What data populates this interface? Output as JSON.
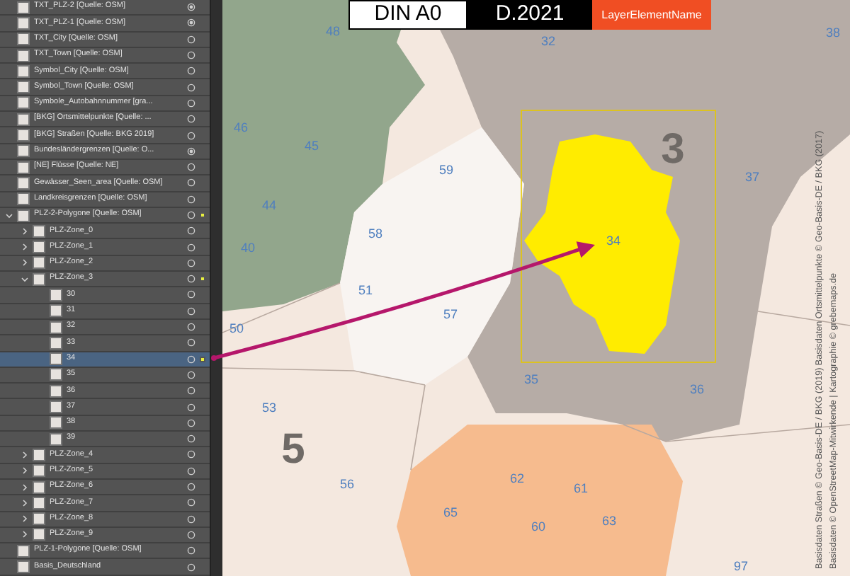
{
  "layers_panel": {
    "layers": [
      {
        "name": "TXT_PLZ-2 [Quelle: OSM]",
        "selected": false,
        "appearance": true,
        "art_selected": false
      },
      {
        "name": "TXT_PLZ-1 [Quelle: OSM]",
        "selected": false,
        "appearance": true,
        "art_selected": false
      },
      {
        "name": "TXT_City [Quelle: OSM]",
        "selected": false,
        "appearance": false,
        "art_selected": false
      },
      {
        "name": "TXT_Town [Quelle: OSM]",
        "selected": false,
        "appearance": false,
        "art_selected": false
      },
      {
        "name": "Symbol_City [Quelle: OSM]",
        "selected": false,
        "appearance": false,
        "art_selected": false
      },
      {
        "name": "Symbol_Town [Quelle: OSM]",
        "selected": false,
        "appearance": false,
        "art_selected": false
      },
      {
        "name": "Symbole_Autobahnnummer [gra...",
        "selected": false,
        "appearance": false,
        "art_selected": false
      },
      {
        "name": "[BKG] Ortsmittelpunkte [Quelle: ...",
        "selected": false,
        "appearance": false,
        "art_selected": false
      },
      {
        "name": "[BKG] Straßen [Quelle: BKG 2019]",
        "selected": false,
        "appearance": false,
        "art_selected": false
      },
      {
        "name": "Bundesländergrenzen [Quelle: O...",
        "selected": false,
        "appearance": true,
        "art_selected": false
      },
      {
        "name": "[NE] Flüsse [Quelle: NE]",
        "selected": false,
        "appearance": false,
        "art_selected": false
      },
      {
        "name": "Gewässer_Seen_area [Quelle: OSM]",
        "selected": false,
        "appearance": false,
        "art_selected": false
      },
      {
        "name": "Landkreisgrenzen [Quelle: OSM]",
        "selected": false,
        "appearance": false,
        "art_selected": false
      },
      {
        "name": "PLZ-2-Polygone [Quelle: OSM]",
        "selected": false,
        "appearance": false,
        "art_selected": true,
        "expanded": true,
        "children": [
          {
            "name": "PLZ-Zone_0",
            "selected": false,
            "appearance": false,
            "art_selected": false,
            "expanded": false
          },
          {
            "name": "PLZ-Zone_1",
            "selected": false,
            "appearance": false,
            "art_selected": false,
            "expanded": false
          },
          {
            "name": "PLZ-Zone_2",
            "selected": false,
            "appearance": false,
            "art_selected": false,
            "expanded": false
          },
          {
            "name": "PLZ-Zone_3",
            "selected": false,
            "appearance": false,
            "art_selected": true,
            "expanded": true,
            "children": [
              {
                "name": "30",
                "selected": false,
                "appearance": false,
                "art_selected": false
              },
              {
                "name": "31",
                "selected": false,
                "appearance": false,
                "art_selected": false
              },
              {
                "name": "32",
                "selected": false,
                "appearance": false,
                "art_selected": false
              },
              {
                "name": "33",
                "selected": false,
                "appearance": false,
                "art_selected": false
              },
              {
                "name": "34",
                "selected": true,
                "appearance": false,
                "art_selected": true
              },
              {
                "name": "35",
                "selected": false,
                "appearance": false,
                "art_selected": false
              },
              {
                "name": "36",
                "selected": false,
                "appearance": false,
                "art_selected": false
              },
              {
                "name": "37",
                "selected": false,
                "appearance": false,
                "art_selected": false
              },
              {
                "name": "38",
                "selected": false,
                "appearance": false,
                "art_selected": false
              },
              {
                "name": "39",
                "selected": false,
                "appearance": false,
                "art_selected": false
              }
            ]
          },
          {
            "name": "PLZ-Zone_4",
            "selected": false,
            "appearance": false,
            "art_selected": false,
            "expanded": false
          },
          {
            "name": "PLZ-Zone_5",
            "selected": false,
            "appearance": false,
            "art_selected": false,
            "expanded": false
          },
          {
            "name": "PLZ-Zone_6",
            "selected": false,
            "appearance": false,
            "art_selected": false,
            "expanded": false
          },
          {
            "name": "PLZ-Zone_7",
            "selected": false,
            "appearance": false,
            "art_selected": false,
            "expanded": false
          },
          {
            "name": "PLZ-Zone_8",
            "selected": false,
            "appearance": false,
            "art_selected": false,
            "expanded": false
          },
          {
            "name": "PLZ-Zone_9",
            "selected": false,
            "appearance": false,
            "art_selected": false,
            "expanded": false
          }
        ]
      },
      {
        "name": "PLZ-1-Polygone [Quelle: OSM]",
        "selected": false,
        "appearance": false,
        "art_selected": false
      },
      {
        "name": "Basis_Deutschland",
        "selected": false,
        "appearance": false,
        "art_selected": false
      }
    ]
  },
  "header_tags": {
    "format": "DIN A0",
    "date": "D.2021",
    "layer_label": "LayerElementName"
  },
  "map": {
    "zone_labels": [
      "48",
      "32",
      "38",
      "46",
      "45",
      "59",
      "37",
      "44",
      "58",
      "34",
      "40",
      "51",
      "57",
      "50",
      "35",
      "36",
      "53",
      "56",
      "62",
      "61",
      "65",
      "60",
      "63",
      "97"
    ],
    "region_numbers": [
      "3",
      "5"
    ],
    "attribution": [
      "Basisdaten Straßen © Geo-Basis-DE / BKG (2019) Basisdaten Ortsmittelpunkte © Geo-Basis-DE / BKG (2017)",
      "Basisdaten © OpenStreetMap-Mitwirkende | Kartographie © grebemaps.de"
    ]
  }
}
